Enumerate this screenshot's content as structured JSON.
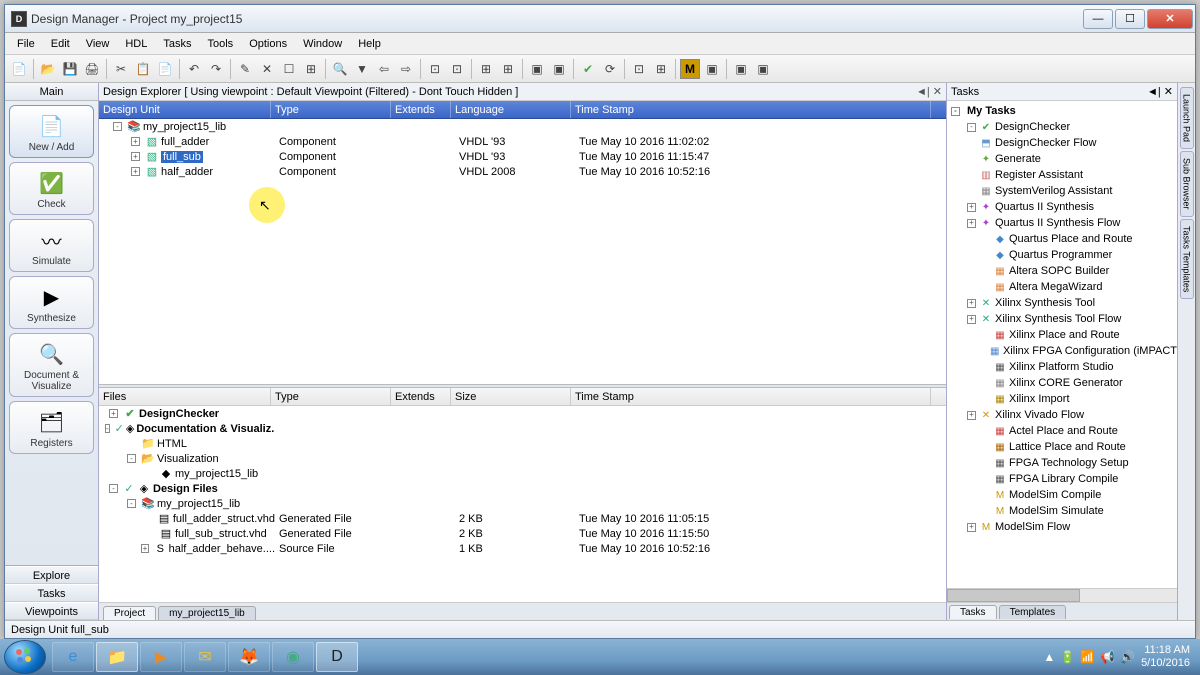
{
  "titlebar": {
    "title": "Design Manager - Project my_project15"
  },
  "menu": [
    "File",
    "Edit",
    "View",
    "HDL",
    "Tasks",
    "Tools",
    "Options",
    "Window",
    "Help"
  ],
  "sidebar": {
    "header": "Main",
    "items": [
      {
        "label": "New / Add",
        "icon": "📄",
        "selected": true
      },
      {
        "label": "Check",
        "icon": "✅",
        "selected": false
      },
      {
        "label": "Simulate",
        "icon": "〰",
        "selected": false
      },
      {
        "label": "Synthesize",
        "icon": "▶",
        "selected": false
      },
      {
        "label": "Document & Visualize",
        "icon": "🔍",
        "selected": false
      },
      {
        "label": "Registers",
        "icon": "🗂",
        "selected": false
      }
    ],
    "tabs": [
      "Explore",
      "Tasks",
      "Viewpoints"
    ]
  },
  "explorer": {
    "subheader": "Design Explorer [ Using viewpoint :  Default Viewpoint (Filtered) - Dont Touch Hidden ]",
    "columns": [
      "Design Unit",
      "Type",
      "Extends",
      "Language",
      "Time Stamp"
    ],
    "widths": [
      172,
      120,
      60,
      120,
      360
    ],
    "rows": [
      {
        "indent": 0,
        "toggle": "-",
        "icon": "📚",
        "name": "my_project15_lib",
        "type": "",
        "extends": "",
        "lang": "",
        "ts": "",
        "sel": false
      },
      {
        "indent": 1,
        "toggle": "+",
        "icon": "▧",
        "name": "full_adder",
        "type": "Component",
        "extends": "",
        "lang": "VHDL '93",
        "ts": "Tue May 10 2016 11:02:02",
        "sel": false
      },
      {
        "indent": 1,
        "toggle": "+",
        "icon": "▧",
        "name": "full_sub",
        "type": "Component",
        "extends": "",
        "lang": "VHDL '93",
        "ts": "Tue May 10 2016 11:15:47",
        "sel": true
      },
      {
        "indent": 1,
        "toggle": "+",
        "icon": "▧",
        "name": "half_adder",
        "type": "Component",
        "extends": "",
        "lang": "VHDL 2008",
        "ts": "Tue May 10 2016 10:52:16",
        "sel": false
      }
    ]
  },
  "files": {
    "columns": [
      "Files",
      "Type",
      "Extends",
      "Size",
      "Time Stamp"
    ],
    "widths": [
      172,
      120,
      60,
      120,
      360
    ],
    "rows": [
      {
        "indent": 0,
        "toggle": "+",
        "check": "",
        "icon": "✔",
        "iconClass": "check",
        "name": "DesignChecker",
        "type": "",
        "size": "",
        "ts": "",
        "bold": true
      },
      {
        "indent": 0,
        "toggle": "-",
        "check": "✓",
        "icon": "◈",
        "iconClass": "",
        "name": "Documentation & Visualiz...",
        "type": "",
        "size": "",
        "ts": "",
        "bold": true
      },
      {
        "indent": 1,
        "toggle": "",
        "check": "",
        "icon": "📁",
        "iconClass": "fold",
        "name": "HTML",
        "type": "",
        "size": "",
        "ts": ""
      },
      {
        "indent": 1,
        "toggle": "-",
        "check": "",
        "icon": "📂",
        "iconClass": "fold",
        "name": "Visualization",
        "type": "",
        "size": "",
        "ts": ""
      },
      {
        "indent": 2,
        "toggle": "",
        "check": "",
        "icon": "◆",
        "iconClass": "",
        "name": "my_project15_lib",
        "type": "",
        "size": "",
        "ts": ""
      },
      {
        "indent": 0,
        "toggle": "-",
        "check": "✓",
        "icon": "◈",
        "iconClass": "",
        "name": "Design Files",
        "type": "",
        "size": "",
        "ts": "",
        "bold": true
      },
      {
        "indent": 1,
        "toggle": "-",
        "check": "",
        "icon": "📚",
        "iconClass": "lib",
        "name": "my_project15_lib",
        "type": "",
        "size": "",
        "ts": ""
      },
      {
        "indent": 2,
        "toggle": "",
        "check": "",
        "icon": "▤",
        "iconClass": "",
        "name": "full_adder_struct.vhd",
        "type": "Generated File",
        "size": "2 KB",
        "ts": "Tue May 10 2016 11:05:15"
      },
      {
        "indent": 2,
        "toggle": "",
        "check": "",
        "icon": "▤",
        "iconClass": "",
        "name": "full_sub_struct.vhd",
        "type": "Generated File",
        "size": "2 KB",
        "ts": "Tue May 10 2016 11:15:50"
      },
      {
        "indent": 2,
        "toggle": "+",
        "check": "",
        "icon": "S",
        "iconClass": "",
        "name": "half_adder_behave....",
        "type": "Source File",
        "size": "1 KB",
        "ts": "Tue May 10 2016 10:52:16"
      }
    ],
    "tabs": [
      "Project",
      "my_project15_lib"
    ]
  },
  "tasks": {
    "header": "Tasks",
    "title": "My Tasks",
    "items": [
      {
        "indent": 1,
        "toggle": "-",
        "icon": "✔",
        "color": "#4a4",
        "name": "DesignChecker"
      },
      {
        "indent": 1,
        "toggle": "",
        "icon": "⬒",
        "color": "#69c",
        "name": "DesignChecker Flow"
      },
      {
        "indent": 1,
        "toggle": "",
        "icon": "✦",
        "color": "#6a4",
        "name": "Generate"
      },
      {
        "indent": 1,
        "toggle": "",
        "icon": "▥",
        "color": "#c66",
        "name": "Register Assistant"
      },
      {
        "indent": 1,
        "toggle": "",
        "icon": "▦",
        "color": "#888",
        "name": "SystemVerilog Assistant"
      },
      {
        "indent": 1,
        "toggle": "+",
        "icon": "✦",
        "color": "#a4c",
        "name": "Quartus II Synthesis"
      },
      {
        "indent": 1,
        "toggle": "+",
        "icon": "✦",
        "color": "#a4c",
        "name": "Quartus II Synthesis Flow"
      },
      {
        "indent": 2,
        "toggle": "",
        "icon": "◆",
        "color": "#48c",
        "name": "Quartus Place and Route"
      },
      {
        "indent": 2,
        "toggle": "",
        "icon": "◆",
        "color": "#48c",
        "name": "Quartus Programmer"
      },
      {
        "indent": 2,
        "toggle": "",
        "icon": "▦",
        "color": "#d84",
        "name": "Altera SOPC Builder"
      },
      {
        "indent": 2,
        "toggle": "",
        "icon": "▦",
        "color": "#d84",
        "name": "Altera MegaWizard"
      },
      {
        "indent": 1,
        "toggle": "+",
        "icon": "✕",
        "color": "#2a8",
        "name": "Xilinx Synthesis Tool"
      },
      {
        "indent": 1,
        "toggle": "+",
        "icon": "✕",
        "color": "#2a8",
        "name": "Xilinx Synthesis Tool Flow"
      },
      {
        "indent": 2,
        "toggle": "",
        "icon": "▦",
        "color": "#c44",
        "name": "Xilinx Place and Route"
      },
      {
        "indent": 2,
        "toggle": "",
        "icon": "▦",
        "color": "#58c",
        "name": "Xilinx FPGA Configuration (iMPACT"
      },
      {
        "indent": 2,
        "toggle": "",
        "icon": "▦",
        "color": "#555",
        "name": "Xilinx Platform Studio"
      },
      {
        "indent": 2,
        "toggle": "",
        "icon": "▦",
        "color": "#888",
        "name": "Xilinx CORE Generator"
      },
      {
        "indent": 2,
        "toggle": "",
        "icon": "▦",
        "color": "#a80",
        "name": "Xilinx Import"
      },
      {
        "indent": 1,
        "toggle": "+",
        "icon": "✕",
        "color": "#c90",
        "name": "Xilinx Vivado Flow"
      },
      {
        "indent": 2,
        "toggle": "",
        "icon": "▦",
        "color": "#c44",
        "name": "Actel Place and Route"
      },
      {
        "indent": 2,
        "toggle": "",
        "icon": "▦",
        "color": "#a60",
        "name": "Lattice Place and Route"
      },
      {
        "indent": 2,
        "toggle": "",
        "icon": "▦",
        "color": "#555",
        "name": "FPGA Technology Setup"
      },
      {
        "indent": 2,
        "toggle": "",
        "icon": "▦",
        "color": "#555",
        "name": "FPGA Library Compile"
      },
      {
        "indent": 2,
        "toggle": "",
        "icon": "M",
        "color": "#c90",
        "name": "ModelSim Compile"
      },
      {
        "indent": 2,
        "toggle": "",
        "icon": "M",
        "color": "#c90",
        "name": "ModelSim Simulate"
      },
      {
        "indent": 1,
        "toggle": "+",
        "icon": "M",
        "color": "#c90",
        "name": "ModelSim Flow"
      }
    ],
    "tabs": [
      "Tasks",
      "Templates"
    ]
  },
  "vtabs": [
    "Launch Pad",
    "Sub Browser",
    "Tasks Templates"
  ],
  "status": "Design Unit full_sub",
  "taskbar": {
    "apps": [
      {
        "icon": "e",
        "color": "#3a8ed8",
        "active": false
      },
      {
        "icon": "📁",
        "color": "#e6c04a",
        "active": true
      },
      {
        "icon": "▶",
        "color": "#e68a2a",
        "active": false
      },
      {
        "icon": "✉",
        "color": "#e6c04a",
        "active": false
      },
      {
        "icon": "🦊",
        "color": "#e66a2a",
        "active": false
      },
      {
        "icon": "◉",
        "color": "#4a8",
        "active": false
      },
      {
        "icon": "D",
        "color": "#222",
        "active": true
      }
    ],
    "tray_icons": [
      "▲",
      "🔋",
      "📶",
      "📢",
      "🔊"
    ],
    "time": "11:18 AM",
    "date": "5/10/2016"
  }
}
